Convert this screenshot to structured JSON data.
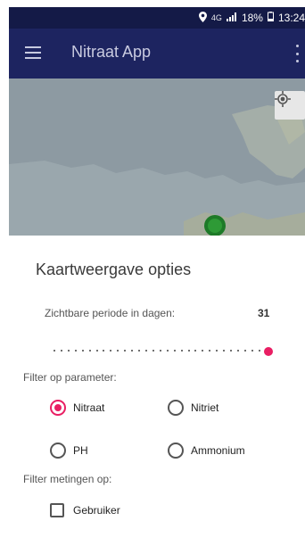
{
  "status_bar": {
    "location_icon": "location-pin-icon",
    "network": "4G",
    "signal_icon": "signal-bars-icon",
    "battery": "18%",
    "battery_icon": "battery-icon",
    "time": "13:24"
  },
  "app_bar": {
    "menu_icon": "hamburger-menu-icon",
    "title": "Nitraat App",
    "overflow_icon": "more-vert-icon",
    "background": "#1d2460"
  },
  "map": {
    "my_location_icon": "my-location-icon",
    "marker_icon": "green-map-marker-icon"
  },
  "sheet": {
    "title": "Kaartweergave opties",
    "period_label": "Zichtbare periode in dagen:",
    "period_value": "31",
    "slider_position": 1.0,
    "accent": "#e91e63",
    "parameter_filter_label": "Filter op parameter:",
    "parameters": [
      {
        "label": "Nitraat",
        "checked": true
      },
      {
        "label": "Nitriet",
        "checked": false
      },
      {
        "label": "PH",
        "checked": false
      },
      {
        "label": "Ammonium",
        "checked": false
      }
    ],
    "measurement_filter_label": "Filter metingen op:",
    "user_filter": {
      "label": "Gebruiker",
      "checked": false
    }
  }
}
